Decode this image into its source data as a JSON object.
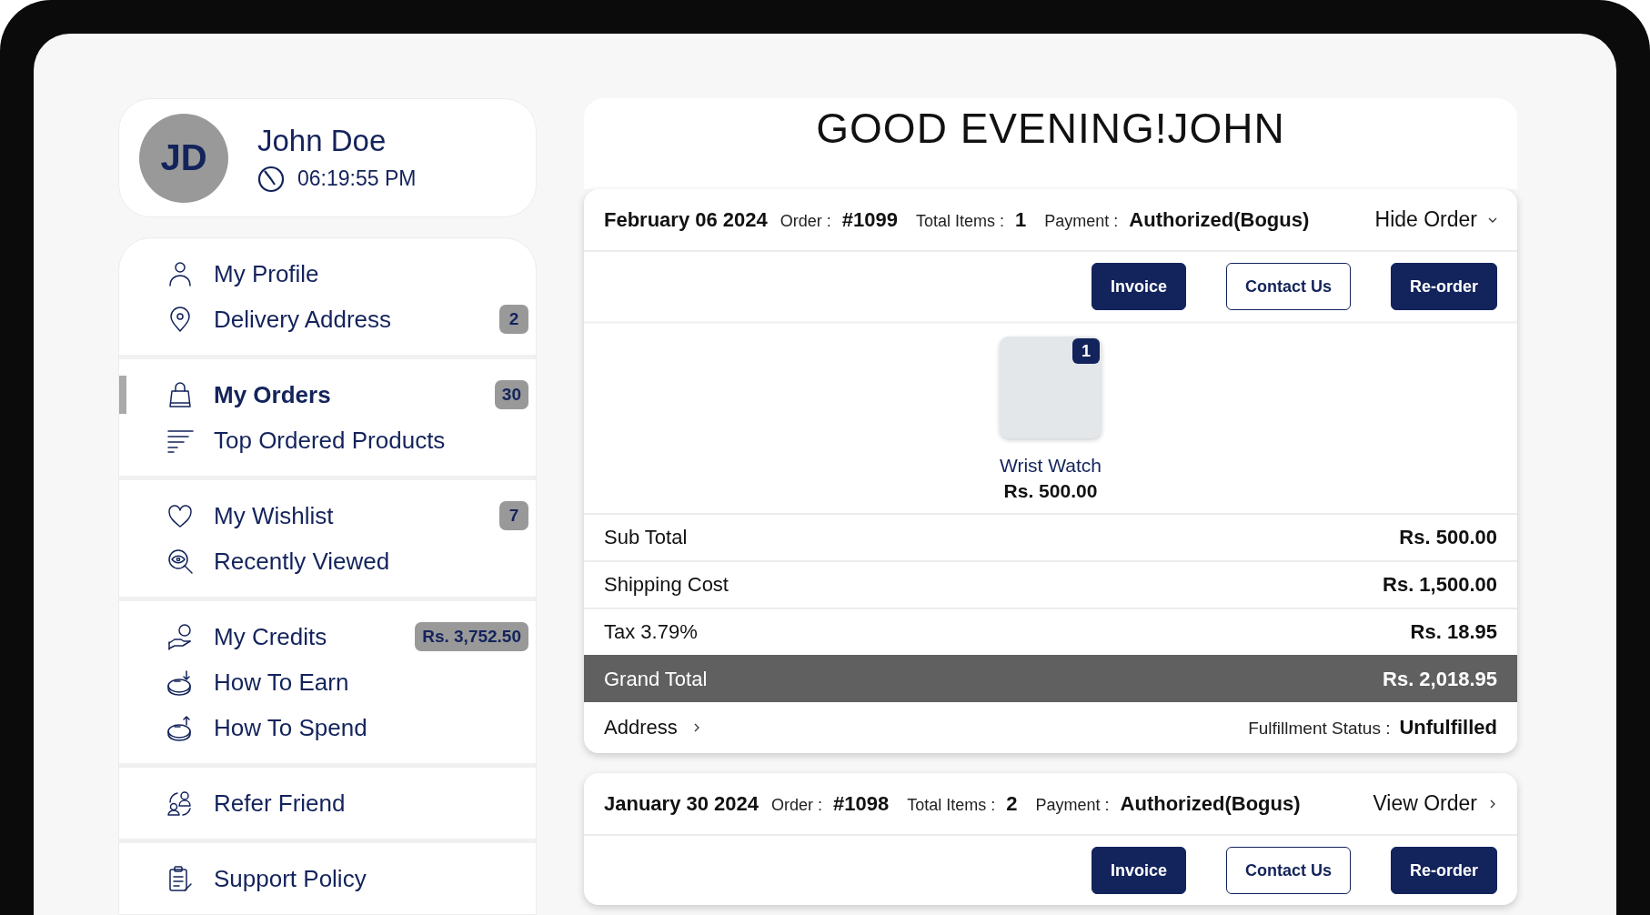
{
  "profile": {
    "initials": "JD",
    "name": "John Doe",
    "time": "06:19:55 PM"
  },
  "nav_groups": [
    {
      "items": [
        {
          "label": "My Profile",
          "selected": false
        },
        {
          "label": "Delivery Address",
          "badge": "2",
          "selected": false
        }
      ]
    },
    {
      "items": [
        {
          "label": "My Orders",
          "badge": "30",
          "selected": true
        },
        {
          "label": "Top Ordered Products",
          "selected": false
        }
      ]
    },
    {
      "items": [
        {
          "label": "My Wishlist",
          "badge": "7",
          "selected": false
        },
        {
          "label": "Recently Viewed",
          "selected": false
        }
      ]
    },
    {
      "items": [
        {
          "label": "My Credits",
          "badge": "Rs. 3,752.50",
          "selected": false
        },
        {
          "label": "How To Earn",
          "selected": false
        },
        {
          "label": "How To Spend",
          "selected": false
        }
      ]
    },
    {
      "items": [
        {
          "label": "Refer Friend",
          "selected": false
        }
      ]
    },
    {
      "items": [
        {
          "label": "Support Policy",
          "selected": false
        }
      ]
    }
  ],
  "greeting": "GOOD EVENING!JOHN",
  "orders": [
    {
      "date": "February 06 2024",
      "fields": [
        {
          "label": "Order :",
          "value": "#1099"
        },
        {
          "label": "Total Items :",
          "value": "1"
        },
        {
          "label": "Payment :",
          "value": "Authorized(Bogus)"
        }
      ],
      "toggle": "Hide Order",
      "expanded": true,
      "buttons": [
        {
          "label": "Invoice",
          "kind": "filled"
        },
        {
          "label": "Contact Us",
          "kind": "outline"
        },
        {
          "label": "Re-order",
          "kind": "filled"
        }
      ],
      "products": [
        {
          "name": "Wrist Watch",
          "price": "Rs. 500.00",
          "qty": "1"
        }
      ],
      "totals": [
        {
          "label": "Sub Total",
          "value": "Rs. 500.00",
          "kind": "normal"
        },
        {
          "label": "Shipping Cost",
          "value": "Rs. 1,500.00",
          "kind": "normal"
        },
        {
          "label": "Tax 3.79%",
          "value": "Rs. 18.95",
          "kind": "normal"
        },
        {
          "label": "Grand Total",
          "value": "Rs. 2,018.95",
          "kind": "grand"
        }
      ],
      "address": "Address",
      "fulfillment_label": "Fulfillment Status :",
      "fulfillment": "Unfulfilled"
    },
    {
      "date": "January 30 2024",
      "fields": [
        {
          "label": "Order :",
          "value": "#1098"
        },
        {
          "label": "Total Items :",
          "value": "2"
        },
        {
          "label": "Payment :",
          "value": "Authorized(Bogus)"
        }
      ],
      "toggle": "View Order",
      "expanded": false,
      "buttons": [
        {
          "label": "Invoice",
          "kind": "filled"
        },
        {
          "label": "Contact Us",
          "kind": "outline"
        },
        {
          "label": "Re-order",
          "kind": "filled"
        }
      ]
    }
  ]
}
